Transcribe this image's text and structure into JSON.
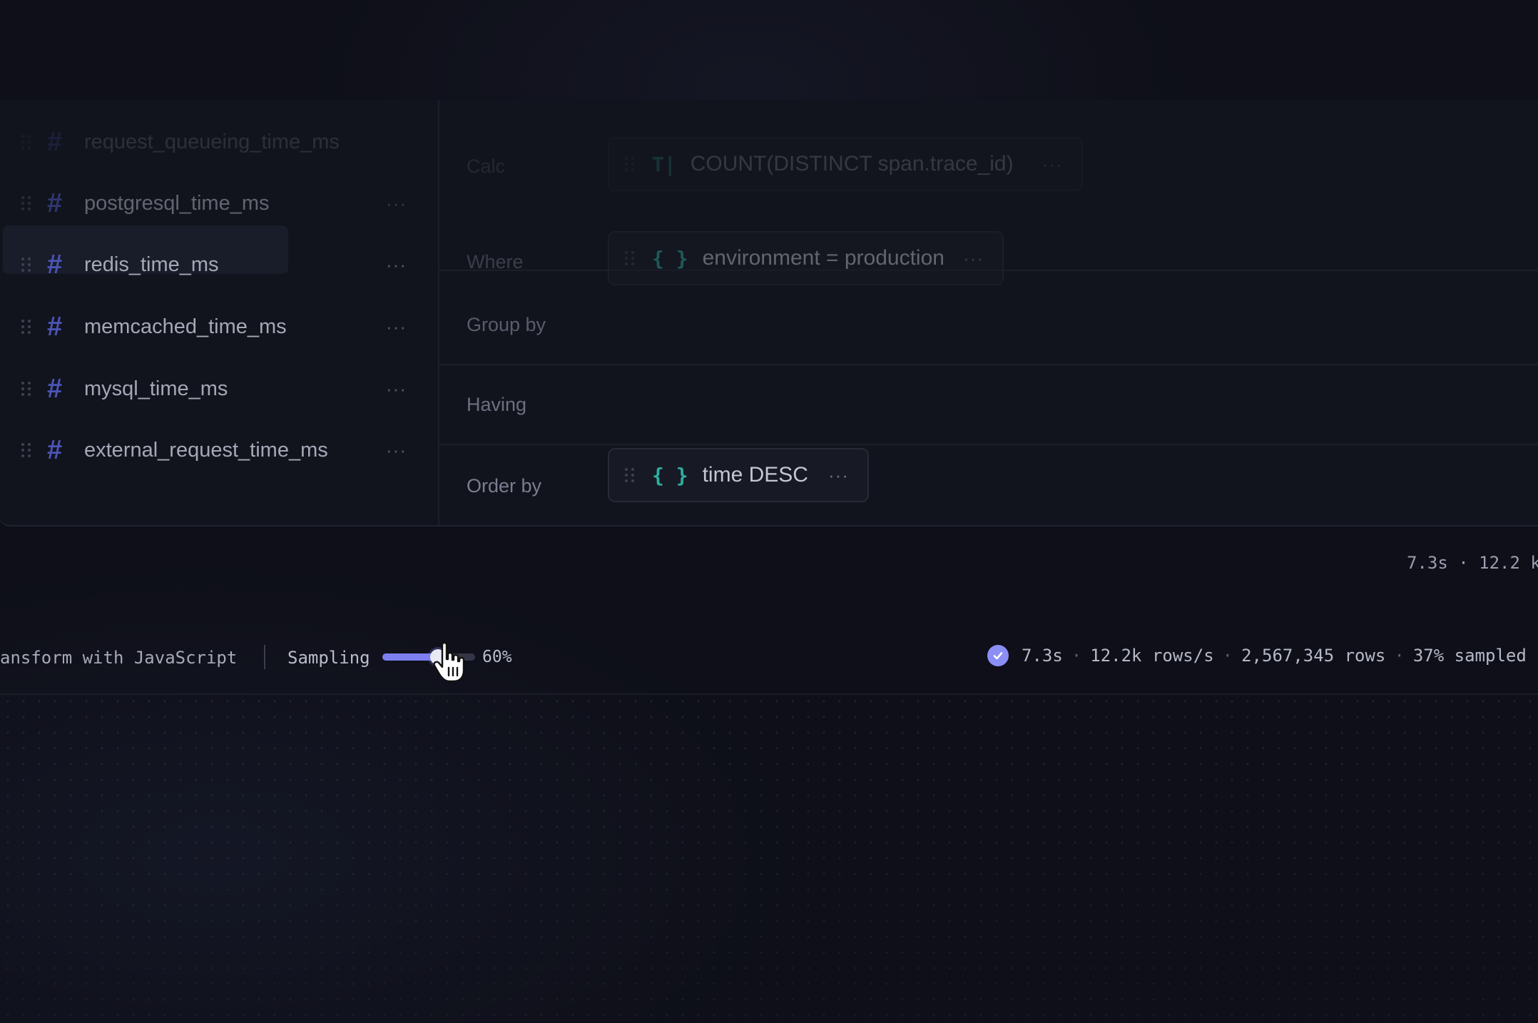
{
  "fields": [
    {
      "name": "request_queueing_time_ms",
      "type_icon": "hash-icon"
    },
    {
      "name": "postgresql_time_ms",
      "type_icon": "hash-icon"
    },
    {
      "name": "redis_time_ms",
      "type_icon": "hash-icon"
    },
    {
      "name": "memcached_time_ms",
      "type_icon": "hash-icon"
    },
    {
      "name": "mysql_time_ms",
      "type_icon": "hash-icon"
    },
    {
      "name": "external_request_time_ms",
      "type_icon": "hash-icon"
    }
  ],
  "field_glyph": "#",
  "more_glyph": "···",
  "clauses": {
    "calc": {
      "label": "Calc",
      "value": "COUNT(DISTINCT span.trace_id)",
      "icon_text": "T|"
    },
    "where": {
      "label": "Where",
      "value": "environment = production",
      "icon_text": "{ }"
    },
    "group_by": {
      "label": "Group by"
    },
    "having": {
      "label": "Having"
    },
    "order_by": {
      "label": "Order by",
      "value": "time DESC",
      "icon_text": "{ }"
    }
  },
  "stats_ghost": "7.3s · 12.2 k",
  "toolbar": {
    "transform_label": "ansform with JavaScript",
    "sampling_label": "Sampling",
    "sampling_value": "60%",
    "sampling_fraction": 0.6
  },
  "status": {
    "duration": "7.3s",
    "rate": "12.2k rows/s",
    "rows": "2,567,345 rows",
    "sampled": "37% sampled",
    "separator": "·"
  },
  "colors": {
    "accent": "#7c7ff0",
    "type_icon": "#4b55b8",
    "brace": "#2faea0",
    "background": "#0e0f18"
  }
}
